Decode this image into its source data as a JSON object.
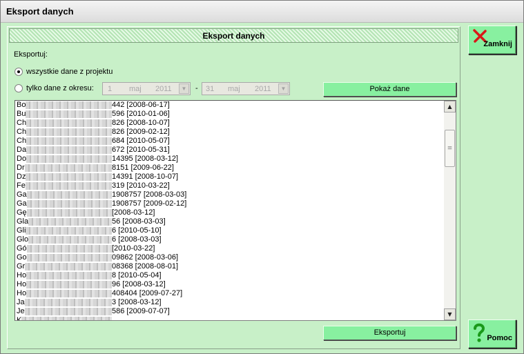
{
  "window": {
    "title": "Eksport danych"
  },
  "panel": {
    "header": "Eksport danych"
  },
  "export": {
    "label": "Eksportuj:",
    "option_all": "wszystkie dane z projektu",
    "option_range": "tylko dane z okresu:",
    "selected": "all",
    "date_from": {
      "day": "1",
      "month": "maj",
      "year": "2011"
    },
    "date_separator": "-",
    "date_to": {
      "day": "31",
      "month": "maj",
      "year": "2011"
    },
    "show_button": "Pokaż dane",
    "export_button": "Eksportuj"
  },
  "list": {
    "items": [
      {
        "name": "Bo",
        "suffix": "442 [2008-06-17]"
      },
      {
        "name": "Bu",
        "suffix": "596 [2010-01-06]"
      },
      {
        "name": "Ch",
        "suffix": "826 [2008-10-07]"
      },
      {
        "name": "Ch",
        "suffix": "826 [2009-02-12]"
      },
      {
        "name": "Ch",
        "suffix": "684 [2010-05-07]"
      },
      {
        "name": "Da",
        "suffix": "672 [2010-05-31]"
      },
      {
        "name": "Do",
        "suffix": "14395 [2008-03-12]"
      },
      {
        "name": "Dr",
        "suffix": "8151 [2009-06-22]"
      },
      {
        "name": "Dz",
        "suffix": "14391 [2008-10-07]"
      },
      {
        "name": "Fe",
        "suffix": "319 [2010-03-22]"
      },
      {
        "name": "Ga",
        "suffix": "1908757 [2008-03-03]"
      },
      {
        "name": "Ga",
        "suffix": "1908757 [2009-02-12]"
      },
      {
        "name": "Gę",
        "suffix": "[2008-03-12]"
      },
      {
        "name": "Gla",
        "suffix": "56 [2008-03-03]"
      },
      {
        "name": "Gli",
        "suffix": "6 [2010-05-10]"
      },
      {
        "name": "Glo",
        "suffix": "6 [2008-03-03]"
      },
      {
        "name": "Gó",
        "suffix": "[2010-03-22]"
      },
      {
        "name": "Go",
        "suffix": "09862 [2008-03-06]"
      },
      {
        "name": "Gr",
        "suffix": "08368 [2008-08-01]"
      },
      {
        "name": "Ho",
        "suffix": "8 [2010-05-04]"
      },
      {
        "name": "Ho",
        "suffix": "96 [2008-03-12]"
      },
      {
        "name": "Ho",
        "suffix": "408404 [2009-07-27]"
      },
      {
        "name": "Ja",
        "suffix": "3 [2008-03-12]"
      },
      {
        "name": "Je",
        "suffix": "586 [2009-07-07]"
      },
      {
        "name": "K",
        "suffix": ""
      }
    ]
  },
  "side": {
    "close_label": "Zamknij",
    "close_icon": "red-x-icon",
    "help_label": "Pomoc",
    "help_icon": "green-question-icon"
  }
}
